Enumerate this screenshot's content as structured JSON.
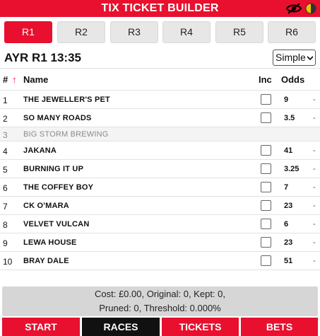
{
  "app": {
    "title": "TIX TICKET BUILDER"
  },
  "colors": {
    "accent": "#e8102e",
    "active_nav": "#111111",
    "summary_bg": "#d6d6d6"
  },
  "tabs": [
    {
      "label": "R1",
      "active": true
    },
    {
      "label": "R2",
      "active": false
    },
    {
      "label": "R3",
      "active": false
    },
    {
      "label": "R4",
      "active": false
    },
    {
      "label": "R5",
      "active": false
    },
    {
      "label": "R6",
      "active": false
    }
  ],
  "race": {
    "title": "AYR R1 13:35",
    "mode": "Simple"
  },
  "table": {
    "columns": {
      "number": "#",
      "sort_arrow": "↑",
      "name": "Name",
      "include": "Inc",
      "odds": "Odds"
    },
    "rows": [
      {
        "num": "1",
        "name": "THE JEWELLER'S PET",
        "odds": "9",
        "dash": "-",
        "scratched": false
      },
      {
        "num": "2",
        "name": "SO MANY ROADS",
        "odds": "3.5",
        "dash": "-",
        "scratched": false
      },
      {
        "num": "3",
        "name": "BIG STORM BREWING",
        "odds": "",
        "dash": "",
        "scratched": true
      },
      {
        "num": "4",
        "name": "JAKANA",
        "odds": "41",
        "dash": "-",
        "scratched": false
      },
      {
        "num": "5",
        "name": "BURNING IT UP",
        "odds": "3.25",
        "dash": "-",
        "scratched": false
      },
      {
        "num": "6",
        "name": "THE COFFEY BOY",
        "odds": "7",
        "dash": "-",
        "scratched": false
      },
      {
        "num": "7",
        "name": "CK O'MARA",
        "odds": "23",
        "dash": "-",
        "scratched": false
      },
      {
        "num": "8",
        "name": "VELVET VULCAN",
        "odds": "6",
        "dash": "-",
        "scratched": false
      },
      {
        "num": "9",
        "name": "LEWA HOUSE",
        "odds": "23",
        "dash": "-",
        "scratched": false
      },
      {
        "num": "10",
        "name": "BRAY DALE",
        "odds": "51",
        "dash": "-",
        "scratched": false
      }
    ]
  },
  "summary": {
    "line1": "Cost: £0.00, Original: 0, Kept: 0,",
    "line2": "Pruned: 0, Threshold: 0.000%"
  },
  "bottom_nav": [
    {
      "label": "START",
      "active": false
    },
    {
      "label": "RACES",
      "active": true
    },
    {
      "label": "TICKETS",
      "active": false
    },
    {
      "label": "BETS",
      "active": false
    }
  ]
}
